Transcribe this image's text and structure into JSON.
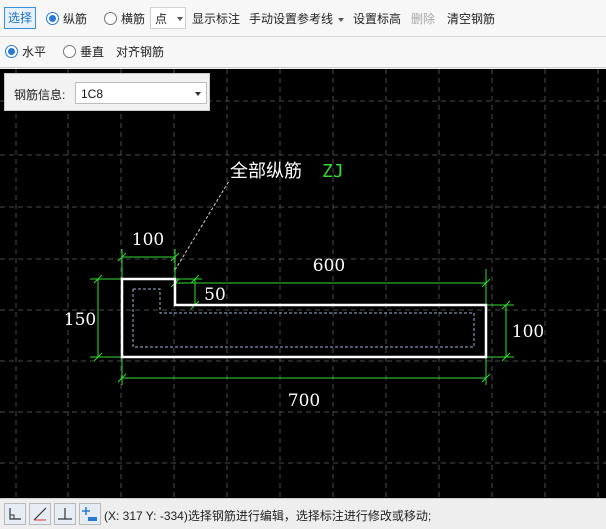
{
  "toolbar": {
    "select_label": "选择",
    "longitudinal_label": "纵筋",
    "transverse_label": "横筋",
    "point_combo_value": "点",
    "show_dimension_label": "显示标注",
    "manual_ref_line_label": "手动设置参考线",
    "set_elevation_label": "设置标高",
    "delete_label": "删除",
    "clear_rebar_label": "清空钢筋"
  },
  "toolbar2": {
    "horizontal_label": "水平",
    "vertical_label": "垂直",
    "align_rebar_label": "对齐钢筋"
  },
  "info_panel": {
    "label": "钢筋信息:",
    "value": "1C8"
  },
  "drawing": {
    "callout_text": "全部纵筋",
    "callout_code": "ZJ",
    "dim_top_left": "100",
    "dim_top_right": "600",
    "dim_notch": "50",
    "dim_left": "150",
    "dim_right": "100",
    "dim_bottom": "700"
  },
  "colors": {
    "canvas_bg": "#000000",
    "rebar_outline": "#ffffff",
    "dimension_line": "#33dd33",
    "callout_code": "#33dd33",
    "grid": "#4a4a4a",
    "accent": "#2a7ad4"
  },
  "statusbar": {
    "coords_text": "(X: 317 Y: -334)选择钢筋进行编辑，选择标注进行修改或移动;",
    "icons": [
      "snap-corner-icon",
      "snap-line-icon",
      "snap-perpendicular-icon",
      "add-dimension-icon"
    ]
  }
}
